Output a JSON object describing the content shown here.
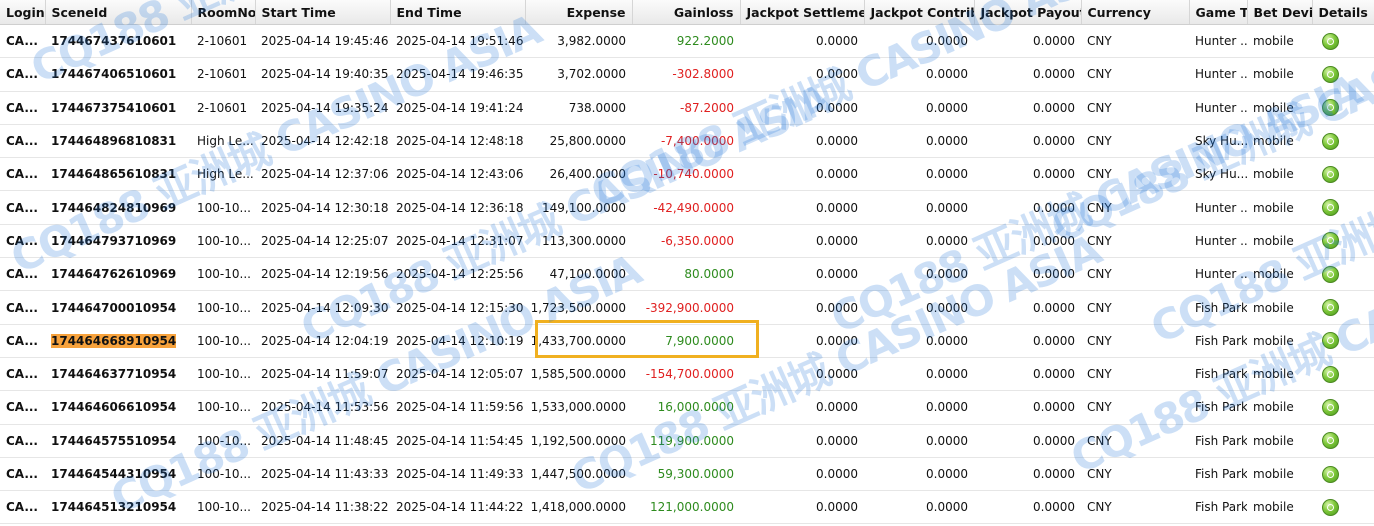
{
  "headers": [
    "Login",
    "SceneId",
    "RoomNo.",
    "Start Time",
    "End Time",
    "Expense",
    "Gainloss",
    "Jackpot Settlement",
    "Jackpot Contribu",
    "Jackpot Payout",
    "Currency",
    "Game Typ",
    "Bet Devic",
    "Details"
  ],
  "watermark": "CQ188 亚洲城 CASINO ASIA",
  "rows": [
    {
      "login": "CA...",
      "scene": "174467437610601",
      "room": "2-10601",
      "start": "2025-04-14 19:45:46",
      "end": "2025-04-14 19:51:46",
      "expense": "3,982.0000",
      "gain": "922.2000",
      "gain_sign": "pos",
      "js": "0.0000",
      "jc": "0.0000",
      "jp": "0.0000",
      "cur": "CNY",
      "game": "Hunter ...",
      "device": "mobile"
    },
    {
      "login": "CA...",
      "scene": "174467406510601",
      "room": "2-10601",
      "start": "2025-04-14 19:40:35",
      "end": "2025-04-14 19:46:35",
      "expense": "3,702.0000",
      "gain": "-302.8000",
      "gain_sign": "neg",
      "js": "0.0000",
      "jc": "0.0000",
      "jp": "0.0000",
      "cur": "CNY",
      "game": "Hunter ...",
      "device": "mobile"
    },
    {
      "login": "CA...",
      "scene": "174467375410601",
      "room": "2-10601",
      "start": "2025-04-14 19:35:24",
      "end": "2025-04-14 19:41:24",
      "expense": "738.0000",
      "gain": "-87.2000",
      "gain_sign": "neg",
      "js": "0.0000",
      "jc": "0.0000",
      "jp": "0.0000",
      "cur": "CNY",
      "game": "Hunter ...",
      "device": "mobile"
    },
    {
      "login": "CA...",
      "scene": "174464896810831",
      "room": "High Le...",
      "start": "2025-04-14 12:42:18",
      "end": "2025-04-14 12:48:18",
      "expense": "25,800.0000",
      "gain": "-7,400.0000",
      "gain_sign": "neg",
      "js": "0.0000",
      "jc": "0.0000",
      "jp": "0.0000",
      "cur": "CNY",
      "game": "Sky Hu...",
      "device": "mobile"
    },
    {
      "login": "CA...",
      "scene": "174464865610831",
      "room": "High Le...",
      "start": "2025-04-14 12:37:06",
      "end": "2025-04-14 12:43:06",
      "expense": "26,400.0000",
      "gain": "-10,740.0000",
      "gain_sign": "neg",
      "js": "0.0000",
      "jc": "0.0000",
      "jp": "0.0000",
      "cur": "CNY",
      "game": "Sky Hu...",
      "device": "mobile"
    },
    {
      "login": "CA...",
      "scene": "174464824810969",
      "room": "100-10...",
      "start": "2025-04-14 12:30:18",
      "end": "2025-04-14 12:36:18",
      "expense": "149,100.0000",
      "gain": "-42,490.0000",
      "gain_sign": "neg",
      "js": "0.0000",
      "jc": "0.0000",
      "jp": "0.0000",
      "cur": "CNY",
      "game": "Hunter ...",
      "device": "mobile"
    },
    {
      "login": "CA...",
      "scene": "174464793710969",
      "room": "100-10...",
      "start": "2025-04-14 12:25:07",
      "end": "2025-04-14 12:31:07",
      "expense": "113,300.0000",
      "gain": "-6,350.0000",
      "gain_sign": "neg",
      "js": "0.0000",
      "jc": "0.0000",
      "jp": "0.0000",
      "cur": "CNY",
      "game": "Hunter ...",
      "device": "mobile"
    },
    {
      "login": "CA...",
      "scene": "174464762610969",
      "room": "100-10...",
      "start": "2025-04-14 12:19:56",
      "end": "2025-04-14 12:25:56",
      "expense": "47,100.0000",
      "gain": "80.0000",
      "gain_sign": "pos",
      "js": "0.0000",
      "jc": "0.0000",
      "jp": "0.0000",
      "cur": "CNY",
      "game": "Hunter ...",
      "device": "mobile"
    },
    {
      "login": "CA...",
      "scene": "174464700010954",
      "room": "100-10...",
      "start": "2025-04-14 12:09:30",
      "end": "2025-04-14 12:15:30",
      "expense": "1,723,500.0000",
      "gain": "-392,900.0000",
      "gain_sign": "neg",
      "js": "0.0000",
      "jc": "0.0000",
      "jp": "0.0000",
      "cur": "CNY",
      "game": "Fish Park",
      "device": "mobile"
    },
    {
      "login": "CA...",
      "scene": "174464668910954",
      "room": "100-10...",
      "start": "2025-04-14 12:04:19",
      "end": "2025-04-14 12:10:19",
      "expense": "1,433,700.0000",
      "gain": "7,900.0000",
      "gain_sign": "pos",
      "js": "0.0000",
      "jc": "0.0000",
      "jp": "0.0000",
      "cur": "CNY",
      "game": "Fish Park",
      "device": "mobile",
      "highlight": true
    },
    {
      "login": "CA...",
      "scene": "174464637710954",
      "room": "100-10...",
      "start": "2025-04-14 11:59:07",
      "end": "2025-04-14 12:05:07",
      "expense": "1,585,500.0000",
      "gain": "-154,700.0000",
      "gain_sign": "neg",
      "js": "0.0000",
      "jc": "0.0000",
      "jp": "0.0000",
      "cur": "CNY",
      "game": "Fish Park",
      "device": "mobile"
    },
    {
      "login": "CA...",
      "scene": "174464606610954",
      "room": "100-10...",
      "start": "2025-04-14 11:53:56",
      "end": "2025-04-14 11:59:56",
      "expense": "1,533,000.0000",
      "gain": "16,000.0000",
      "gain_sign": "pos",
      "js": "0.0000",
      "jc": "0.0000",
      "jp": "0.0000",
      "cur": "CNY",
      "game": "Fish Park",
      "device": "mobile"
    },
    {
      "login": "CA...",
      "scene": "174464575510954",
      "room": "100-10...",
      "start": "2025-04-14 11:48:45",
      "end": "2025-04-14 11:54:45",
      "expense": "1,192,500.0000",
      "gain": "119,900.0000",
      "gain_sign": "pos",
      "js": "0.0000",
      "jc": "0.0000",
      "jp": "0.0000",
      "cur": "CNY",
      "game": "Fish Park",
      "device": "mobile"
    },
    {
      "login": "CA...",
      "scene": "174464544310954",
      "room": "100-10...",
      "start": "2025-04-14 11:43:33",
      "end": "2025-04-14 11:49:33",
      "expense": "1,447,500.0000",
      "gain": "59,300.0000",
      "gain_sign": "pos",
      "js": "0.0000",
      "jc": "0.0000",
      "jp": "0.0000",
      "cur": "CNY",
      "game": "Fish Park",
      "device": "mobile"
    },
    {
      "login": "CA...",
      "scene": "174464513210954",
      "room": "100-10...",
      "start": "2025-04-14 11:38:22",
      "end": "2025-04-14 11:44:22",
      "expense": "1,418,000.0000",
      "gain": "121,000.0000",
      "gain_sign": "pos",
      "js": "0.0000",
      "jc": "0.0000",
      "jp": "0.0000",
      "cur": "CNY",
      "game": "Fish Park",
      "device": "mobile"
    }
  ]
}
